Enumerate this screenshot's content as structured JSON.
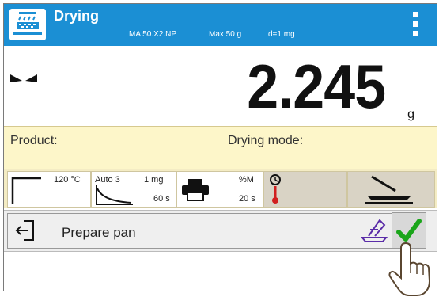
{
  "header": {
    "title": "Drying",
    "model": "MA 50.X2.NP",
    "max": "Max 50 g",
    "division": "d=1 mg"
  },
  "weight": {
    "value": "2.245",
    "unit": "g"
  },
  "info": {
    "product_label": "Product:",
    "mode_label": "Drying mode:"
  },
  "params": {
    "temperature": "120 °C",
    "auto_mode": "Auto 3",
    "auto_mass": "1 mg",
    "auto_time": "60 s",
    "result_unit": "%M",
    "interval": "20 s"
  },
  "action": {
    "message": "Prepare pan"
  },
  "colors": {
    "header_bg": "#1b8fd4",
    "info_bg": "#fdf6c9",
    "accept_green": "#1aa51a",
    "thermo_red": "#d11f1f"
  },
  "icons": [
    "drying-logo-icon",
    "menu-icon",
    "stability-icon",
    "printer-icon",
    "timer-thermometer-icon",
    "pan-icon",
    "exit-icon",
    "tare-icon",
    "accept-icon",
    "hand-icon"
  ]
}
